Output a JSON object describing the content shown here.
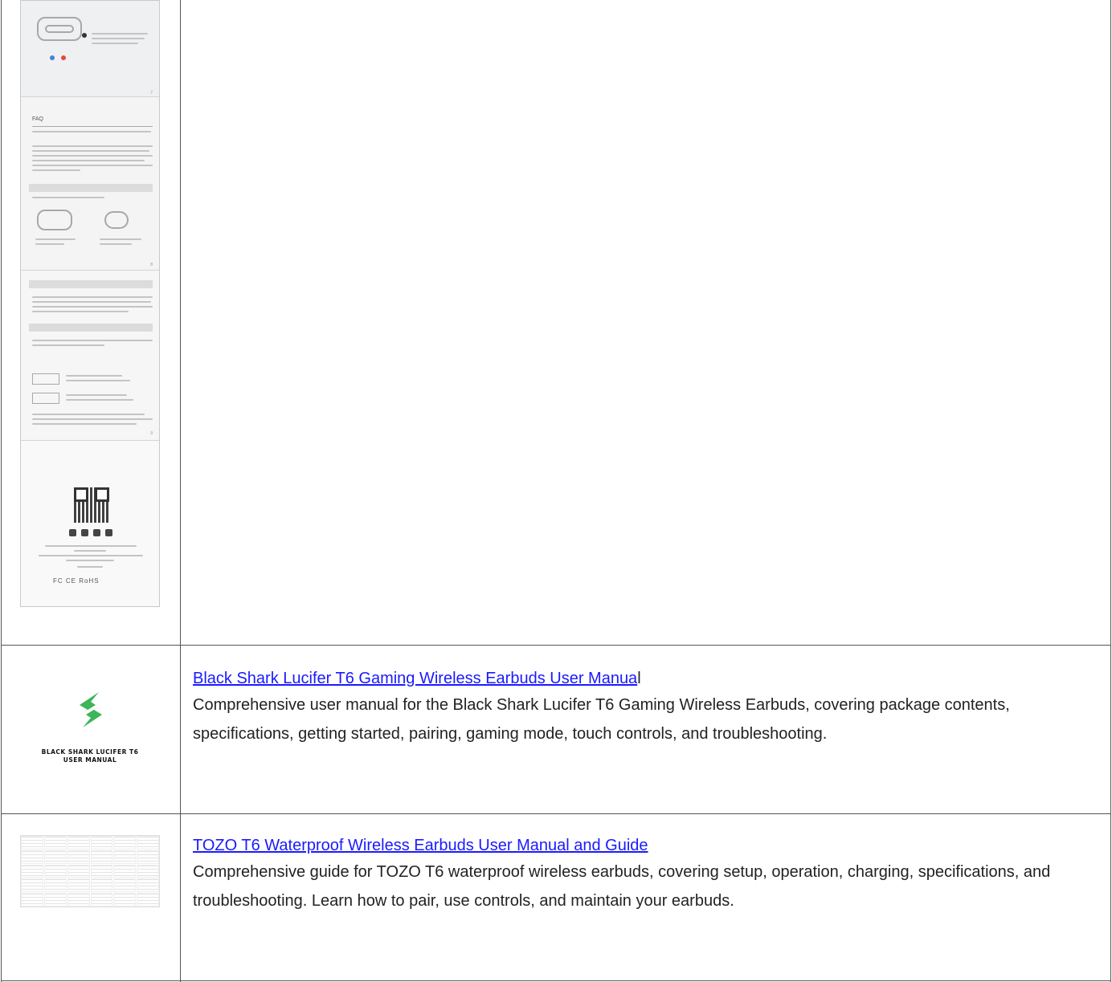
{
  "rows": [
    {
      "thumb": "japanese-manual-pages",
      "booklet": {
        "faq_heading": "FAQ",
        "cert_marks": "FC CE RoHS"
      }
    },
    {
      "thumb": "black-shark-logo",
      "logo_caption_line1": "BLACK SHARK LUCIFER T6",
      "logo_caption_line2": "USER MANUAL",
      "logo_color": "#3db559",
      "link_text": "Black Shark Lucifer T6 Gaming Wireless Earbuds User Manua",
      "link_tail": "l",
      "description": "Comprehensive user manual for the Black Shark Lucifer T6 Gaming Wireless Earbuds, covering package contents, specifications, getting started, pairing, gaming mode, touch controls, and troubleshooting."
    },
    {
      "thumb": "tozo-manual-grid",
      "link_text": "TOZO T6 Waterproof Wireless Earbuds User Manual and Guide",
      "description": "Comprehensive guide for TOZO T6 waterproof wireless earbuds, covering setup, operation, charging, specifications, and troubleshooting. Learn how to pair, use controls, and maintain your earbuds."
    }
  ],
  "colors": {
    "link": "#1a1aff",
    "border": "#555555"
  }
}
